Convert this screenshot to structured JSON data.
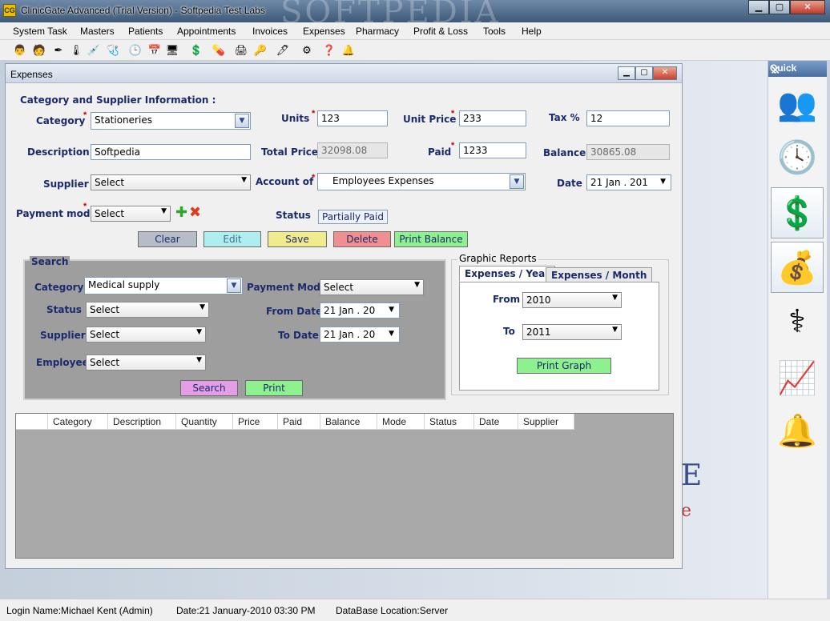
{
  "window": {
    "title": "ClinicGate Advanced (Trial Version) - Softpedia Test Labs",
    "watermark": "SOFTPEDIA"
  },
  "menu": [
    "System Task",
    "Masters",
    "Patients",
    "Appointments",
    "Invoices",
    "Expenses",
    "Pharmacy",
    "Profit & Loss",
    "Tools",
    "Help"
  ],
  "toolbar_icons": [
    "doctor-icon",
    "patient-icon",
    "syringe-icon",
    "thermometer-icon",
    "injection-icon",
    "stethoscope-icon",
    "clock-icon",
    "calendar-icon",
    "monitor-icon",
    "dollar-icon",
    "medicine-icon",
    "printer-icon",
    "key-icon",
    "pen-icon",
    "settings-icon",
    "help-icon",
    "bell-icon"
  ],
  "quick": {
    "title": "Quick",
    "close": "✕"
  },
  "expenses": {
    "title": "Expenses",
    "section_title": "Category and Supplier Information :",
    "labels": {
      "category": "Category",
      "units": "Units",
      "unit_price": "Unit Price",
      "tax": "Tax %",
      "description": "Description",
      "total_price": "Total Price",
      "paid": "Paid",
      "balance": "Balance",
      "supplier": "Supplier",
      "account_of": "Account of",
      "date": "Date",
      "payment_mode": "Payment mode",
      "status": "Status"
    },
    "values": {
      "category": "Stationeries",
      "units": "123",
      "unit_price": "233",
      "tax": "12",
      "description": "Softpedia",
      "total_price": "32098.08",
      "paid": "1233",
      "balance": "30865.08",
      "supplier": "Select",
      "account_of": "Employees Expenses",
      "date": "21 Jan . 201",
      "payment_mode": "Select",
      "status": "Partially Paid"
    },
    "buttons": {
      "clear": "Clear",
      "edit": "Edit",
      "save": "Save",
      "delete": "Delete",
      "print_balance": "Print Balance"
    },
    "search": {
      "title": "Search",
      "labels": {
        "category": "Category",
        "payment_mode": "Payment Mode",
        "status": "Status",
        "from_date": "From Date",
        "supplier": "Supplier",
        "to_date": "To Date",
        "employee": "Employee"
      },
      "values": {
        "category": "Medical supply",
        "payment_mode": "Select",
        "status": "Select",
        "from_date": "21 Jan . 20",
        "supplier": "Select",
        "to_date": "21 Jan . 20",
        "employee": "Select"
      },
      "buttons": {
        "search": "Search",
        "print": "Print"
      }
    },
    "graphic_reports": {
      "title": "Graphic Reports",
      "tabs": [
        "Expenses / Year",
        "Expenses / Month"
      ],
      "from_label": "From",
      "from_value": "2010",
      "to_label": "To",
      "to_value": "2011",
      "print_graph": "Print Graph"
    },
    "grid_columns": [
      "Category",
      "Description",
      "Quantity",
      "Price",
      "Paid",
      "Balance",
      "Mode",
      "Status",
      "Date",
      "Supplier"
    ]
  },
  "statusbar": {
    "login": "Login Name:Michael Kent (Admin)",
    "date": "Date:21 January-2010  03:30  PM",
    "db": "DataBase Location:Server"
  }
}
